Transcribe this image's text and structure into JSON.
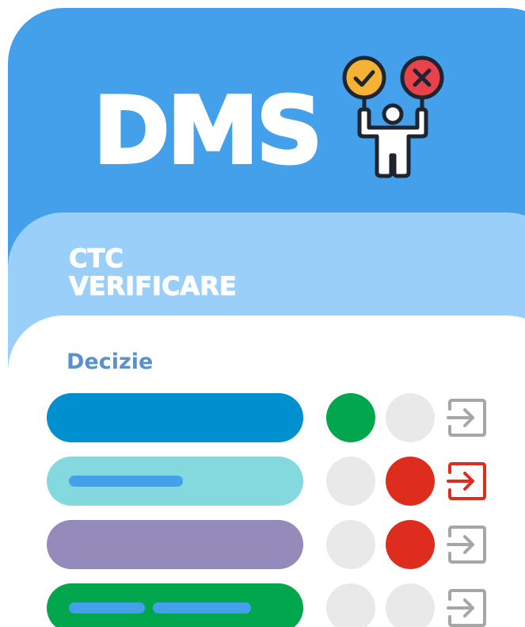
{
  "header": {
    "title": "DMS",
    "mascot_icon": "approve-reject-person-icon"
  },
  "sub_header": {
    "line1": "CTC",
    "line2": "VERIFICARE"
  },
  "decision": {
    "label": "Decizie",
    "rows": [
      {
        "bar_color": "#0090d0",
        "pills": 0,
        "approve": "active",
        "reject": "inactive",
        "enter_icon": "enter-icon",
        "enter_color": "#a6a6a6"
      },
      {
        "bar_color": "#83d9de",
        "pills": 1,
        "approve": "inactive",
        "reject": "active",
        "enter_icon": "enter-icon",
        "enter_color": "#de2d1f"
      },
      {
        "bar_color": "#948bba",
        "pills": 0,
        "approve": "inactive",
        "reject": "active",
        "enter_icon": "enter-icon",
        "enter_color": "#a6a6a6"
      },
      {
        "bar_color": "#02a64d",
        "pills": 2,
        "approve": "inactive",
        "reject": "inactive",
        "enter_icon": "enter-icon",
        "enter_color": "#a6a6a6"
      }
    ]
  },
  "colors": {
    "header_bg": "#44a0eb",
    "sub_header_bg": "#99cff8",
    "label": "#5b90ca",
    "approve": "#02a64d",
    "reject": "#de2d1f",
    "inactive": "#e9e9e9",
    "pill": "#44a0eb"
  }
}
